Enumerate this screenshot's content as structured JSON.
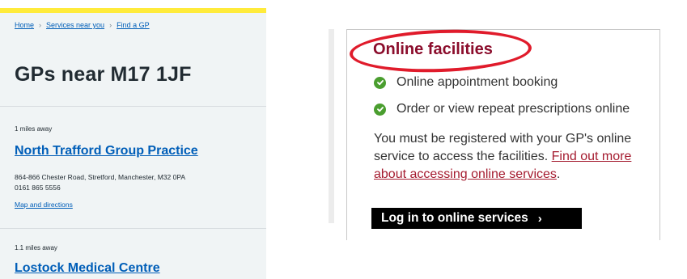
{
  "nhs": {
    "breadcrumb": [
      "Home",
      "Services near you",
      "Find a GP"
    ],
    "title": "GPs near M17 1JF",
    "results": [
      {
        "distance": "1 miles away",
        "name": "North Trafford Group Practice",
        "address": "864-866 Chester Road, Stretford, Manchester, M32 0PA",
        "phone": "0161 865 5556",
        "map_link": "Map and directions"
      },
      {
        "distance": "1.1 miles away",
        "name": "Lostock Medical Centre"
      }
    ]
  },
  "facilities": {
    "title": "Online facilities",
    "items": [
      "Online appointment booking",
      "Order or view repeat prescriptions online"
    ],
    "note_prefix": "You must be registered with your GP's online service to access the facilities. ",
    "note_link": "Find out more about accessing online services",
    "note_suffix": ".",
    "login_label": "Log in to online services",
    "icons": {
      "check": "check-circle-icon",
      "chevron": "chevron-right-icon"
    },
    "colors": {
      "title": "#8b0d2c",
      "highlight_ellipse": "#e01b2b",
      "check": "#4a9e2f",
      "link": "#a51c30"
    }
  }
}
